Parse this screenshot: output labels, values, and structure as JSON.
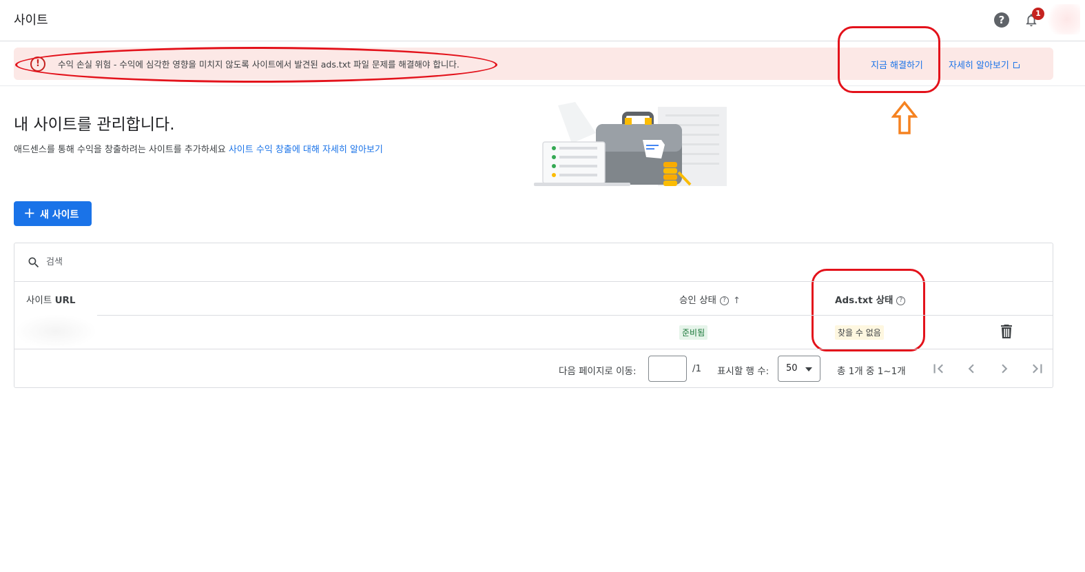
{
  "header": {
    "title": "사이트",
    "help_icon_label": "?",
    "notification_count": "1"
  },
  "alert": {
    "icon_label": "!",
    "message": "수익 손실 위험 - 수익에 심각한 영향을 미치지 않도록 사이트에서 발견된 ads.txt 파일 문제를 해결해야 합니다.",
    "fix_label": "지금 해결하기",
    "learn_label": "자세히 알아보기"
  },
  "intro": {
    "heading": "내 사이트를 관리합니다.",
    "description": "애드센스를 통해 수익을 창출하려는 사이트를 추가하세요",
    "learn_link": "사이트 수익 창출에 대해 자세히 알아보기"
  },
  "actions": {
    "new_site_label": "새 사이트",
    "plus_glyph": "+"
  },
  "table": {
    "search_placeholder": "검색",
    "columns": {
      "url_prefix": "사이트",
      "url_bold": "URL",
      "approval": "승인 상태",
      "ads_txt": "Ads.txt 상태",
      "help_glyph": "?",
      "sort_glyph": "↑"
    },
    "rows": [
      {
        "url": "",
        "approval_status": "준비됨",
        "ads_txt_status": "찾을 수 없음"
      }
    ],
    "pagination": {
      "goto_label": "다음 페이지로 이동:",
      "page_value": "",
      "page_total": "/1",
      "rows_label": "표시할 행 수:",
      "rows_value": "50",
      "range_label": "총 1개 중 1~1개"
    }
  },
  "colors": {
    "accent": "#1a73e8",
    "alert_bg": "#fce8e6",
    "error": "#c5221f",
    "annotation_red": "#e3121b",
    "annotation_orange": "#f58220"
  }
}
